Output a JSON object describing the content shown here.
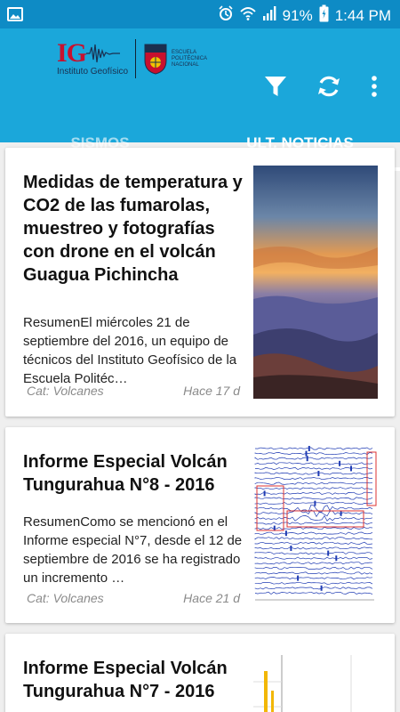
{
  "status_bar": {
    "battery": "91%",
    "time": "1:44 PM",
    "icons": [
      "image-icon",
      "alarm-icon",
      "wifi-icon",
      "signal-icon",
      "battery-icon"
    ]
  },
  "app_bar": {
    "logo": {
      "mark": "IG",
      "institute": "Instituto Geofísico",
      "partner": "ESCUELA POLITÉCNICA NACIONAL"
    },
    "actions": [
      "filter-icon",
      "refresh-icon",
      "more-vert-icon"
    ],
    "colors": {
      "status": "#0e8bc5",
      "toolbar": "#1ba7da"
    }
  },
  "tabs": [
    {
      "label": "SISMOS",
      "active": false
    },
    {
      "label": "ULT. NOTICIAS",
      "active": true
    }
  ],
  "news": [
    {
      "title": "Medidas de temperatura y CO2 de las fumarolas, muestreo y fotografías con drone en el volcán Guagua Pichincha",
      "summary": "ResumenEl miércoles 21 de septiembre del 2016, un equipo de técnicos del Instituto Geofísico de la Escuela Politéc…",
      "category": "Cat: Volcanes",
      "ago": "Hace 17 d",
      "image": "sunset-landscape-photo"
    },
    {
      "title": "Informe Especial Volcán Tungurahua N°8 - 2016",
      "summary": "ResumenComo se mencionó en el Informe especial N°7, desde el 12 de septiembre de 2016 se ha registrado un incremento …",
      "category": "Cat: Volcanes",
      "ago": "Hace 21 d",
      "image": "seismogram-image"
    },
    {
      "title": "Informe Especial Volcán Tungurahua N°7 - 2016",
      "image": "chart-image"
    }
  ]
}
